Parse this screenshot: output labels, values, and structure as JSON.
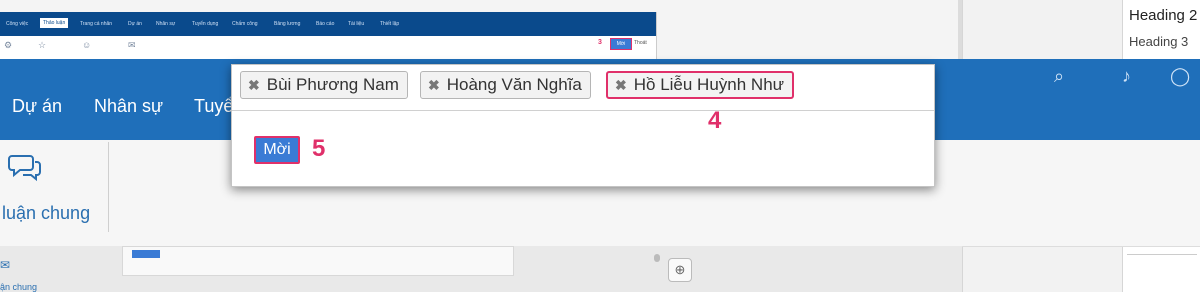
{
  "mini_nav": {
    "tabs": [
      "Công việc",
      "Thảo luận",
      "Trang cá nhân",
      "Dự án",
      "Nhân sự",
      "Tuyển dụng",
      "Chấm công",
      "Bảng lương",
      "Báo cáo",
      "Tài liệu",
      "Thiết lập"
    ],
    "active_index": 1,
    "step_label": "3",
    "invite_label": "Mời",
    "exit_label": "Thoát"
  },
  "band_nav": {
    "items": [
      "Dự án",
      "Nhân sự",
      "Tuyể"
    ]
  },
  "sub_bar": {
    "discussion_label": "luận chung"
  },
  "lower": {
    "partial_label": "ận chung"
  },
  "styles_pane": {
    "heading2": "Heading 2",
    "heading3": "Heading 3"
  },
  "modal": {
    "tags": [
      {
        "name": "Bùi Phương Nam",
        "highlighted": false
      },
      {
        "name": "Hoàng Văn Nghĩa",
        "highlighted": false
      },
      {
        "name": "Hồ Liễu Huỳnh Như",
        "highlighted": true
      }
    ],
    "remove_glyph": "✖",
    "step4": "4",
    "invite_button": "Mời",
    "step5": "5"
  },
  "colors": {
    "brand_blue": "#1f6fba",
    "annotation_pink": "#e0306a",
    "button_blue": "#3a7bd5"
  }
}
